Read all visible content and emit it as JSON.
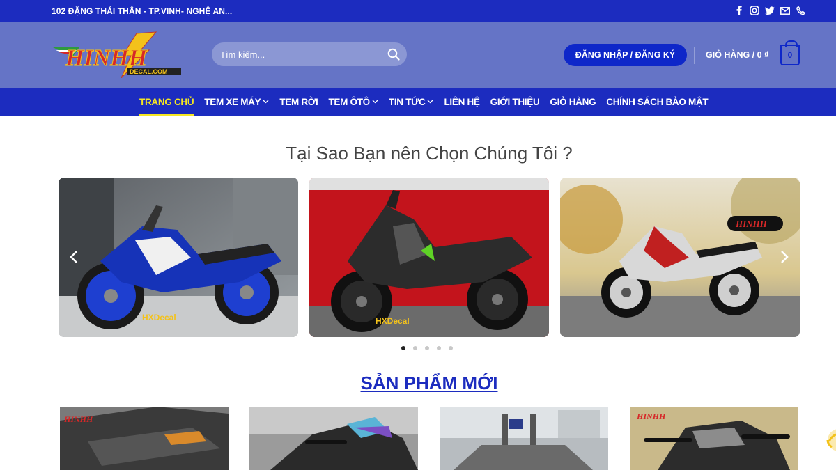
{
  "topbar": {
    "address": "102 ĐẶNG THÁI THÂN - TP.VINH- NGHỆ AN...",
    "social_icons": [
      "facebook-icon",
      "instagram-icon",
      "twitter-icon",
      "email-icon",
      "phone-icon"
    ]
  },
  "header": {
    "logo_text": "HINHH",
    "logo_sub": "DECAL.COM",
    "search_placeholder": "Tìm kiếm...",
    "login_label": "ĐĂNG NHẬP / ĐĂNG KÝ",
    "cart_label": "GIỎ HÀNG / 0 ₫",
    "cart_count": "0"
  },
  "nav": {
    "items": [
      {
        "label": "TRANG CHỦ",
        "dropdown": false
      },
      {
        "label": "TEM XE MÁY",
        "dropdown": true
      },
      {
        "label": "TEM RỜI",
        "dropdown": false
      },
      {
        "label": "TEM ÔTÔ",
        "dropdown": true
      },
      {
        "label": "TIN TỨC",
        "dropdown": true
      },
      {
        "label": "LIÊN HỆ",
        "dropdown": false
      },
      {
        "label": "GIỚI THIỆU",
        "dropdown": false
      },
      {
        "label": "GIỎ HÀNG",
        "dropdown": false
      },
      {
        "label": "CHÍNH SÁCH BẢO MẬT",
        "dropdown": false
      }
    ]
  },
  "why_heading": "Tại Sao Bạn nên Chọn Chúng Tôi ?",
  "slider": {
    "slide_count": 5,
    "active_index": 0,
    "watermark": "HXDecal"
  },
  "new_products_heading": "SẢN PHẨM MỚI",
  "colors": {
    "topbar": "#1c2cbf",
    "header": "#6574c6",
    "accent": "#0e27c9",
    "active_nav": "#f5e623"
  }
}
